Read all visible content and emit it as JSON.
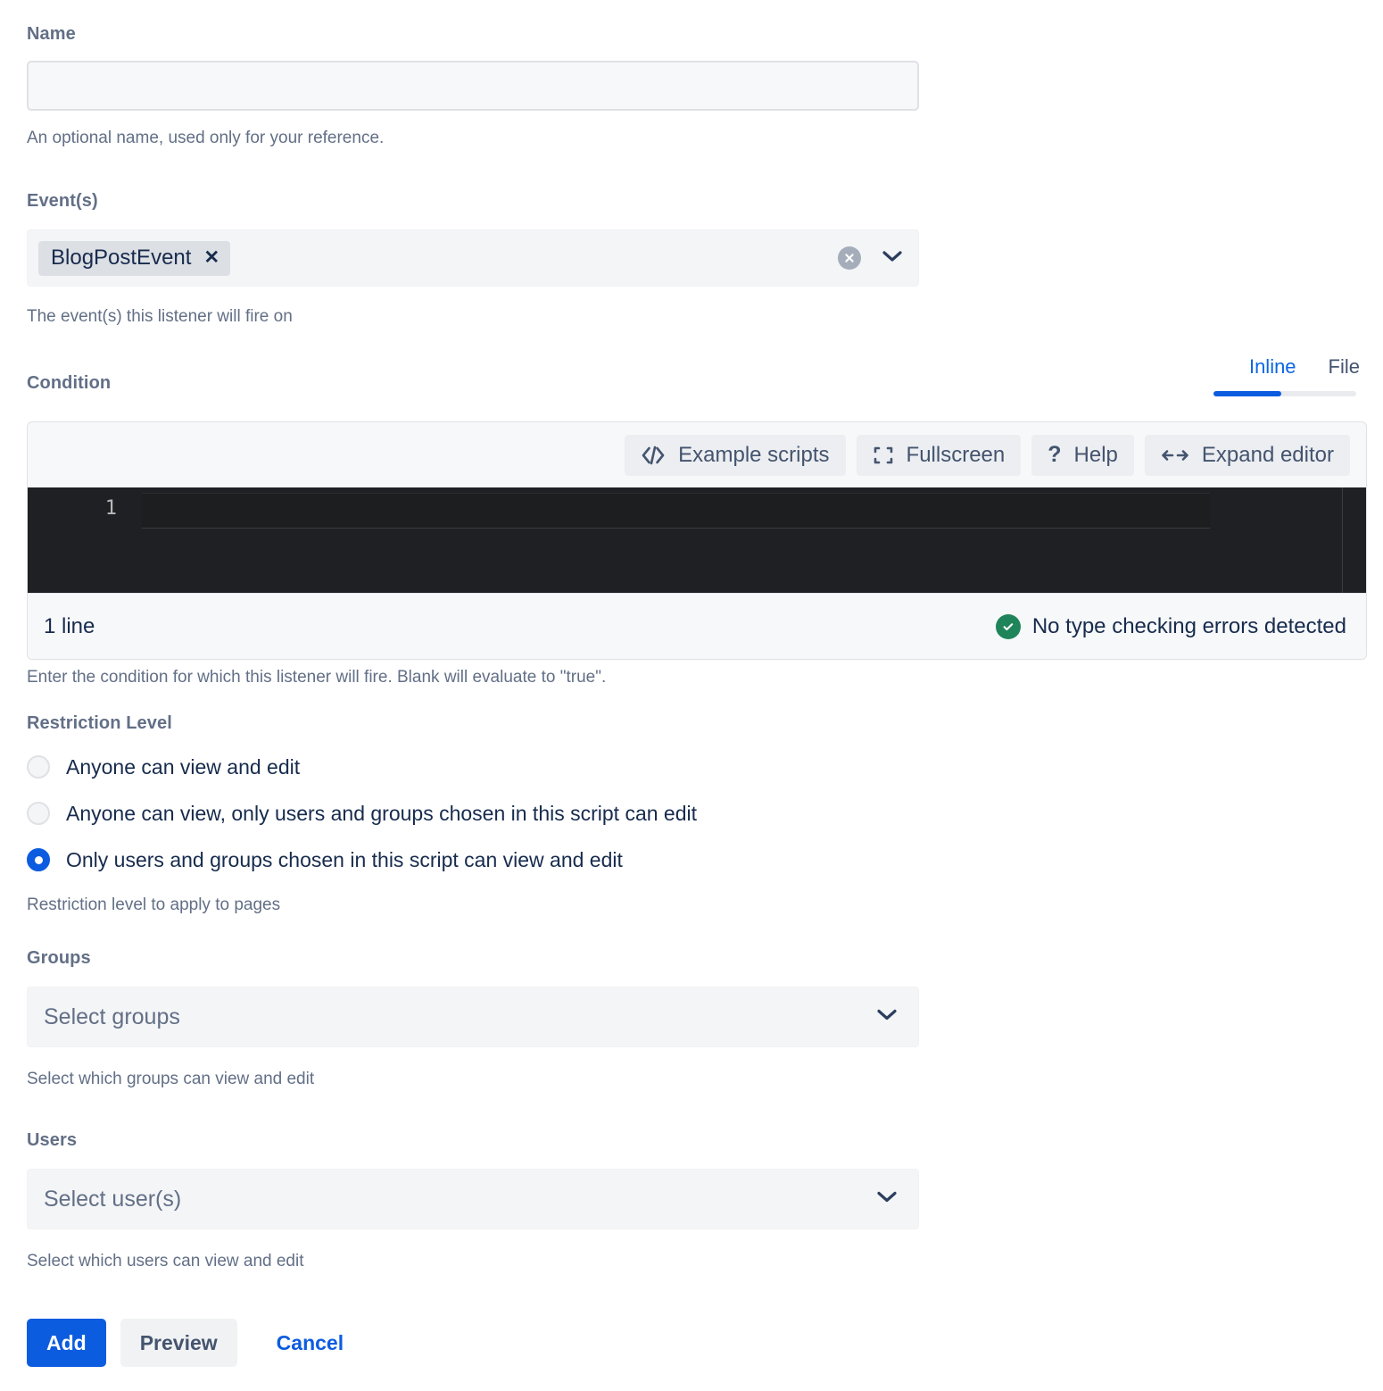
{
  "name_field": {
    "label": "Name",
    "value": "",
    "placeholder": "",
    "help": "An optional name, used only for your reference."
  },
  "events_field": {
    "label": "Event(s)",
    "chips": [
      {
        "label": "BlogPostEvent",
        "remove_glyph": "✕"
      }
    ],
    "clear_icon": "clear-circle-icon",
    "chevron_icon": "chevron-down-icon",
    "help": "The event(s) this listener will fire on"
  },
  "condition": {
    "label": "Condition",
    "tabs": [
      {
        "label": "Inline",
        "active": true
      },
      {
        "label": "File",
        "active": false
      }
    ],
    "toolbar": [
      {
        "label": "Example scripts",
        "icon": "code-brackets-icon"
      },
      {
        "label": "Fullscreen",
        "icon": "fullscreen-corners-icon"
      },
      {
        "label": "Help",
        "icon": "question-mark-icon"
      },
      {
        "label": "Expand editor",
        "icon": "left-right-arrows-icon"
      }
    ],
    "editor": {
      "line_numbers": [
        "1"
      ],
      "code": ""
    },
    "status": {
      "left": "1 line",
      "right": "No type checking errors detected",
      "right_icon": "green-check-circle-icon"
    },
    "help": "Enter the condition for which this listener will fire. Blank will evaluate to \"true\"."
  },
  "restriction": {
    "label": "Restriction Level",
    "options": [
      {
        "label": "Anyone can view and edit",
        "selected": false
      },
      {
        "label": "Anyone can view, only users and groups chosen in this script can edit",
        "selected": false
      },
      {
        "label": "Only users and groups chosen in this script can view and edit",
        "selected": true
      }
    ],
    "help": "Restriction level to apply to pages"
  },
  "groups_field": {
    "label": "Groups",
    "placeholder": "Select groups",
    "chevron_icon": "chevron-down-icon",
    "help": "Select which groups can view and edit"
  },
  "users_field": {
    "label": "Users",
    "placeholder": "Select user(s)",
    "chevron_icon": "chevron-down-icon",
    "help": "Select which users can view and edit"
  },
  "actions": {
    "add_label": "Add",
    "preview_label": "Preview",
    "cancel_label": "Cancel"
  },
  "colors": {
    "accent_blue": "#0c5ce0",
    "link_blue": "#0c66e4",
    "label_gray": "#626f86",
    "text_navy": "#172b4d",
    "field_bg": "#f4f5f7",
    "editor_bg": "#1f2023",
    "success_green": "#1f845a",
    "chip_bg": "#dcdfe4"
  }
}
